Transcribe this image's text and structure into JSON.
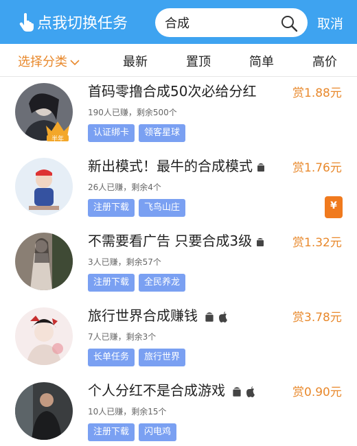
{
  "header": {
    "switch_task_label": "点我切换任务",
    "search_value": "合成",
    "cancel_label": "取消"
  },
  "tabs": {
    "category": "选择分类",
    "latest": "最新",
    "pinned": "置顶",
    "simple": "简单",
    "high_price": "高价"
  },
  "colors": {
    "header_bg": "#3ea3f0",
    "accent_orange": "#e8882b",
    "tag_bg": "#7aa0f2"
  },
  "tasks": [
    {
      "title": "首码零撸合成50次必给分红",
      "meta": "190人已赚，剩余500个",
      "tags": [
        "认证绑卡",
        "领客星球"
      ],
      "reward": "赏1.88元",
      "badge": "半年",
      "platform_icons": []
    },
    {
      "title": "新出模式！最牛的合成模式",
      "meta": "26人已赚，剩余4个",
      "tags": [
        "注册下载",
        "飞鸟山庄"
      ],
      "reward": "赏1.76元",
      "platform_icons": [
        "android-icon"
      ]
    },
    {
      "title": "不需要看广告 只要合成3级",
      "meta": "3人已赚，剩余57个",
      "tags": [
        "注册下载",
        "全民养龙"
      ],
      "reward": "赏1.32元",
      "platform_icons": [
        "android-icon"
      ]
    },
    {
      "title": "旅行世界合成赚钱",
      "meta": "7人已赚，剩余3个",
      "tags": [
        "长单任务",
        "旅行世界"
      ],
      "reward": "赏3.78元",
      "platform_icons": [
        "android-icon",
        "apple-icon"
      ]
    },
    {
      "title": "个人分红不是合成游戏",
      "meta": "10人已赚，剩余15个",
      "tags": [
        "注册下载",
        "闪电鸡"
      ],
      "reward": "赏0.90元",
      "platform_icons": [
        "android-icon",
        "apple-icon"
      ]
    }
  ],
  "floating": {
    "redpack_symbol": "¥"
  }
}
